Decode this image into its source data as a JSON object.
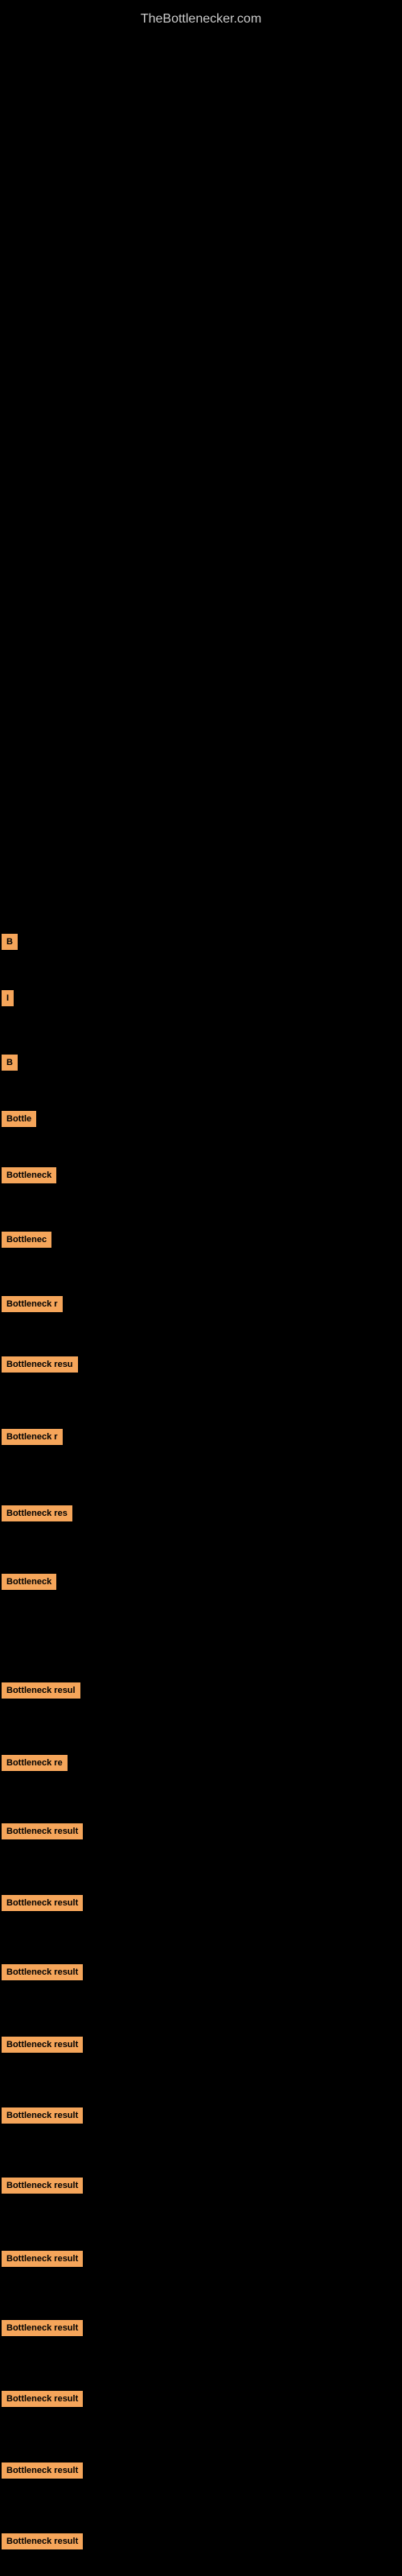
{
  "site": {
    "title": "TheBottlenecker.com"
  },
  "items": [
    {
      "id": 1,
      "label": "B",
      "width": "short"
    },
    {
      "id": 2,
      "label": "I",
      "width": "short"
    },
    {
      "id": 3,
      "label": "B",
      "width": "short"
    },
    {
      "id": 4,
      "label": "Bottle",
      "width": "short"
    },
    {
      "id": 5,
      "label": "Bottleneck",
      "width": "medium"
    },
    {
      "id": 6,
      "label": "Bottlenec",
      "width": "medium"
    },
    {
      "id": 7,
      "label": "Bottleneck r",
      "width": "medium-long"
    },
    {
      "id": 8,
      "label": "Bottleneck resu",
      "width": "long"
    },
    {
      "id": 9,
      "label": "Bottleneck r",
      "width": "medium-long"
    },
    {
      "id": 10,
      "label": "Bottleneck res",
      "width": "long"
    },
    {
      "id": 11,
      "label": "Bottleneck",
      "width": "medium"
    },
    {
      "id": 12,
      "label": "Bottleneck resul",
      "width": "long"
    },
    {
      "id": 13,
      "label": "Bottleneck re",
      "width": "long"
    },
    {
      "id": 14,
      "label": "Bottleneck result",
      "width": "full"
    },
    {
      "id": 15,
      "label": "Bottleneck result",
      "width": "full"
    },
    {
      "id": 16,
      "label": "Bottleneck result",
      "width": "full"
    },
    {
      "id": 17,
      "label": "Bottleneck result",
      "width": "full"
    },
    {
      "id": 18,
      "label": "Bottleneck result",
      "width": "full"
    },
    {
      "id": 19,
      "label": "Bottleneck result",
      "width": "full"
    },
    {
      "id": 20,
      "label": "Bottleneck result",
      "width": "full"
    },
    {
      "id": 21,
      "label": "Bottleneck result",
      "width": "full"
    },
    {
      "id": 22,
      "label": "Bottleneck result",
      "width": "full"
    },
    {
      "id": 23,
      "label": "Bottleneck result",
      "width": "full"
    },
    {
      "id": 24,
      "label": "Bottleneck result",
      "width": "full"
    }
  ]
}
